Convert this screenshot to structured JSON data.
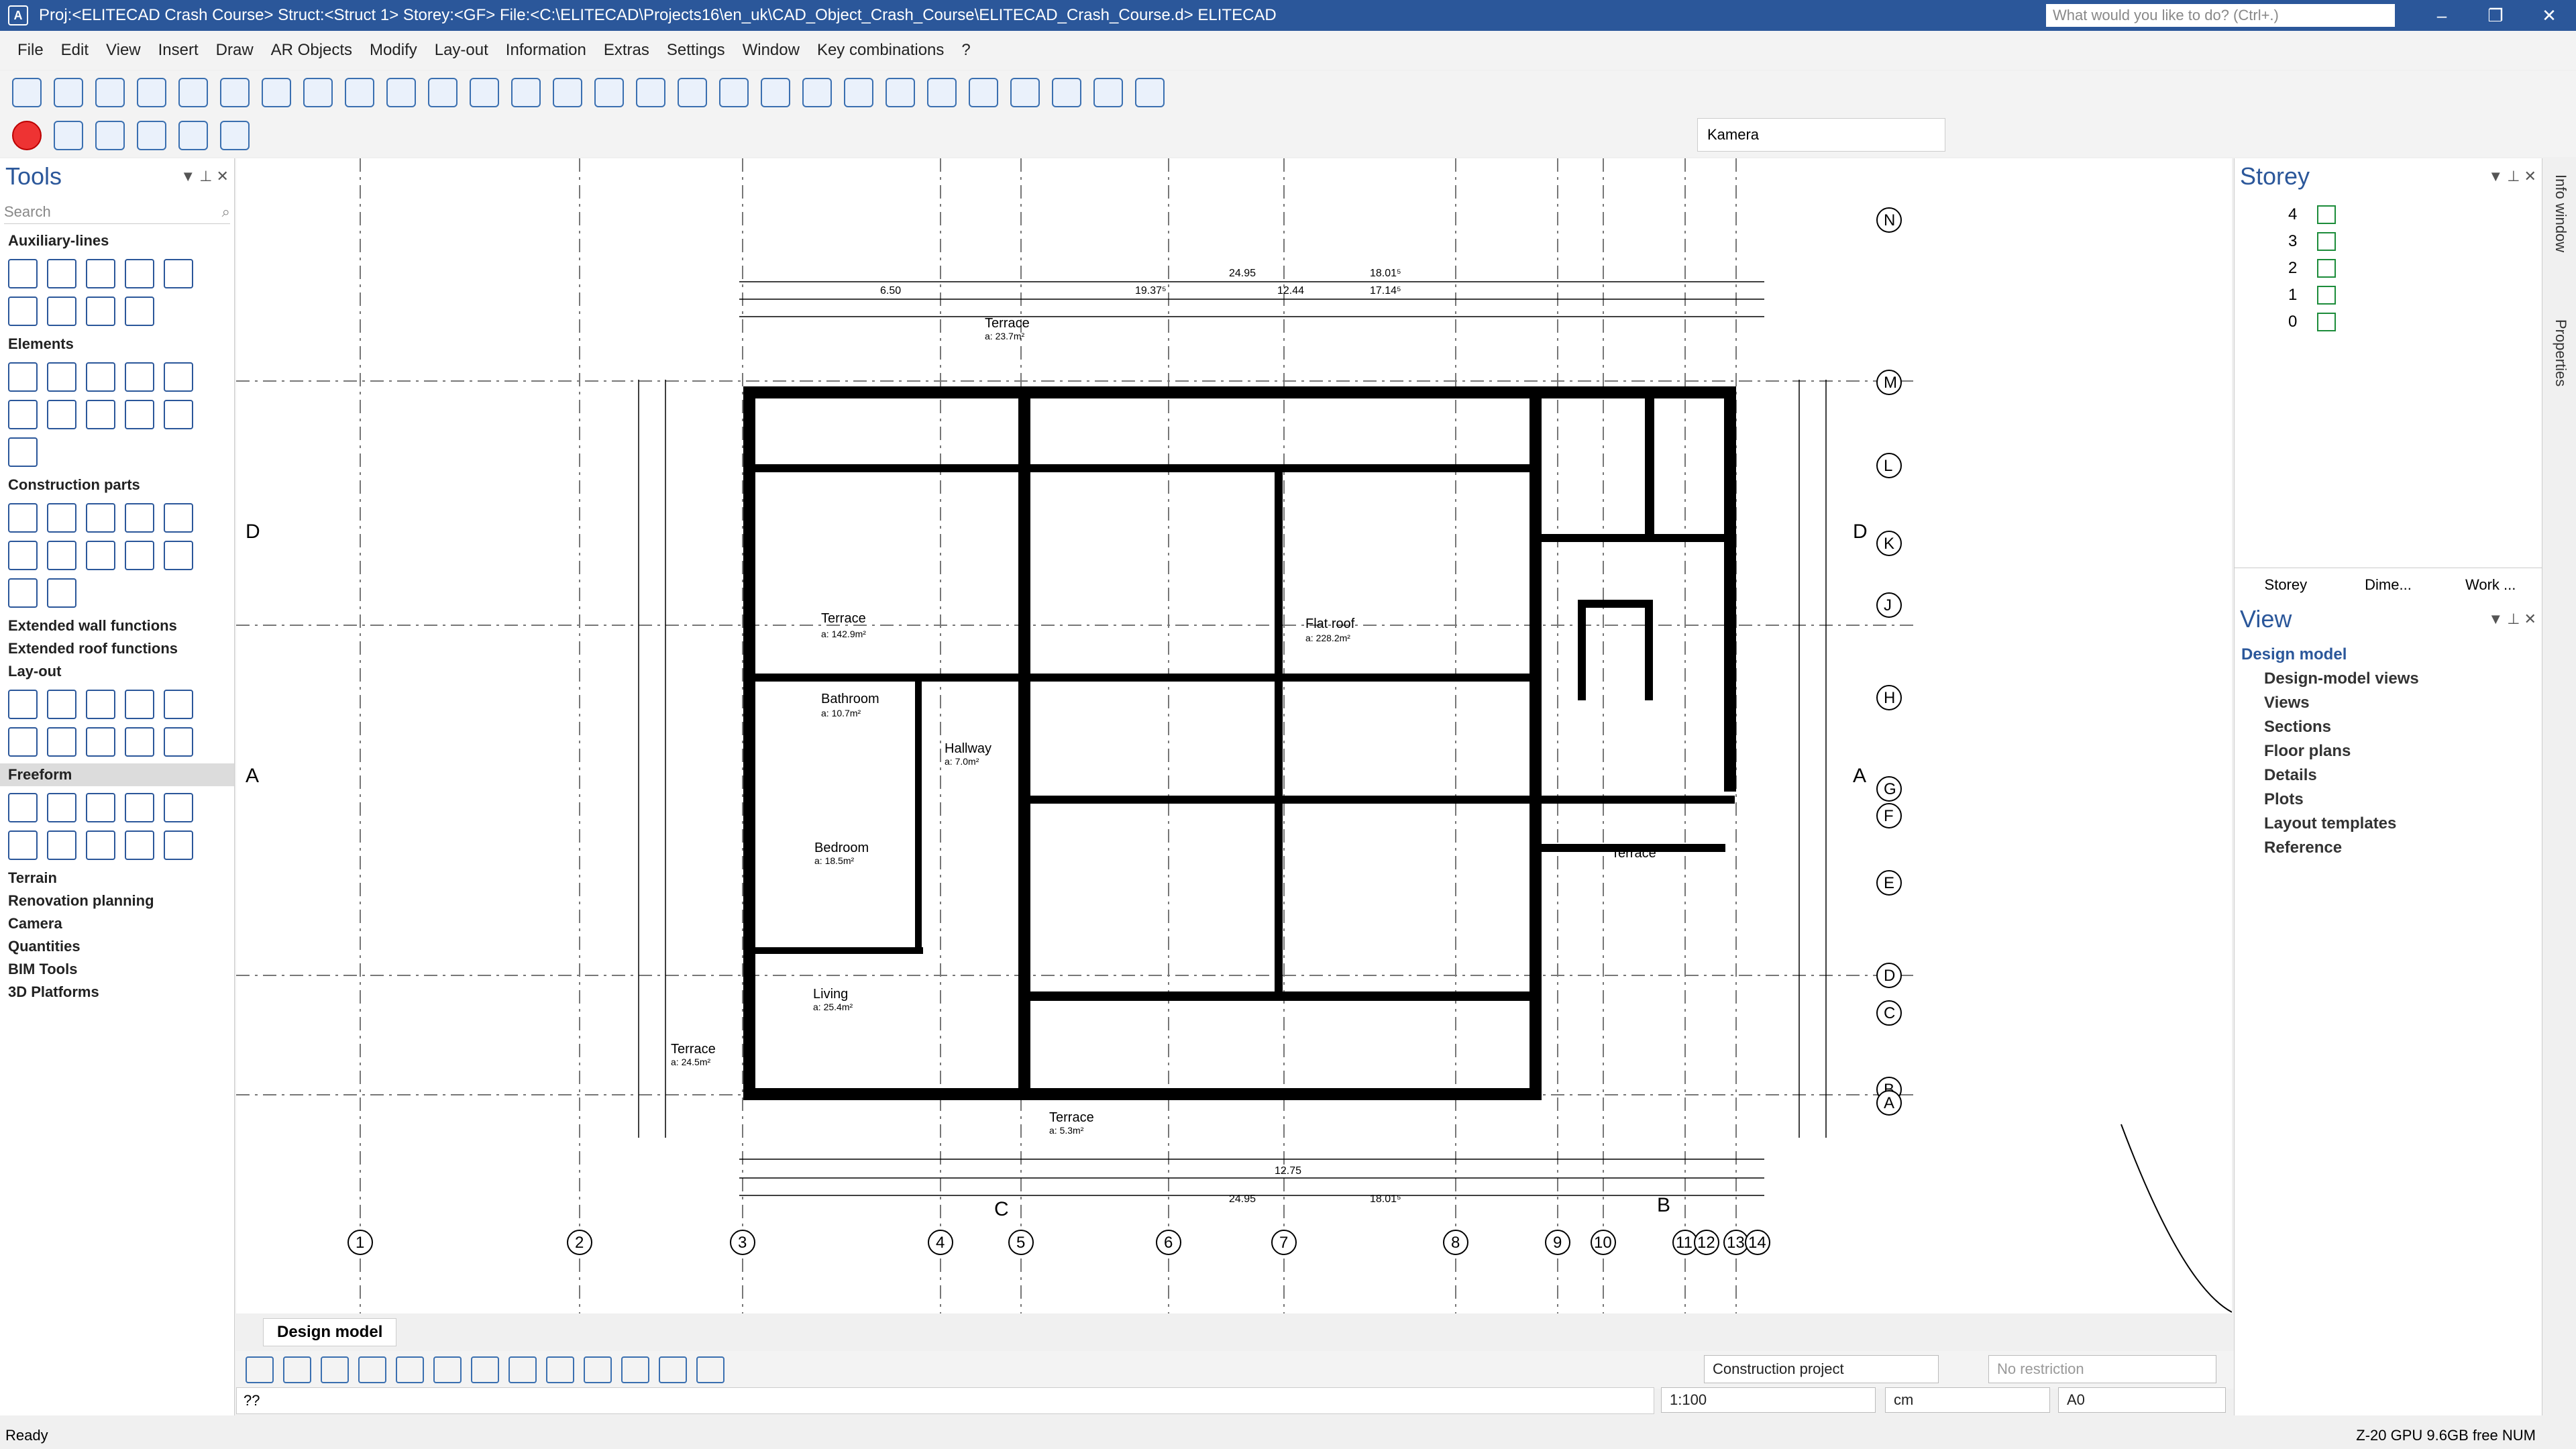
{
  "titlebar": {
    "title": "Proj:<ELITECAD Crash Course>  Struct:<Struct 1>  Storey:<GF>  File:<C:\\ELITECAD\\Projects16\\en_uk\\CAD_Object_Crash_Course\\ELITECAD_Crash_Course.d>  ELITECAD",
    "search_placeholder": "What would you like to do? (Ctrl+.)",
    "minimize": "–",
    "restore": "❐",
    "close": "✕"
  },
  "menu": [
    "File",
    "Edit",
    "View",
    "Insert",
    "Draw",
    "AR Objects",
    "Modify",
    "Lay-out",
    "Information",
    "Extras",
    "Settings",
    "Window",
    "Key combinations",
    "?"
  ],
  "kamera": "Kamera",
  "tools": {
    "title": "Tools",
    "search": "Search",
    "sections": {
      "aux": "Auxiliary-lines",
      "elements": "Elements",
      "construction": "Construction parts",
      "ext_wall": "Extended wall functions",
      "ext_roof": "Extended roof functions",
      "layout": "Lay-out",
      "freeform": "Freeform",
      "terrain": "Terrain",
      "renovation": "Renovation planning",
      "camera": "Camera",
      "quantities": "Quantities",
      "bim": "BIM Tools",
      "platforms": "3D Platforms"
    }
  },
  "storey": {
    "title": "Storey",
    "levels": [
      "4",
      "3",
      "2",
      "1",
      "0"
    ],
    "tabs": [
      "Storey",
      "Dime...",
      "Work ..."
    ]
  },
  "view": {
    "title": "View",
    "root": "Design model",
    "items": [
      "Design-model views",
      "Views",
      "Sections",
      "Floor plans",
      "Details",
      "Plots",
      "Layout templates",
      "Reference"
    ]
  },
  "side": {
    "info": "Info window",
    "props": "Properties"
  },
  "plan": {
    "rooms": [
      {
        "name": "Terrace",
        "area": "a: 142.9m²"
      },
      {
        "name": "Flat roof",
        "area": "a: 228.2m²"
      },
      {
        "name": "Bathroom",
        "area": "a: 10.7m²"
      },
      {
        "name": "Hallway",
        "area": "a: 7.0m²"
      },
      {
        "name": "Bedroom",
        "area": "a: 18.5m²"
      },
      {
        "name": "Living",
        "area": "a: 25.4m²"
      },
      {
        "name": "Terrace",
        "area": "a: 24.5m²"
      },
      {
        "name": "Terrace",
        "area": "a: 5.3m²"
      },
      {
        "name": "Terrace",
        "area": "a: 23.7m²"
      },
      {
        "name": "Terrace",
        "area": ""
      }
    ],
    "grid_bottom": [
      "1",
      "2",
      "3",
      "4",
      "5",
      "6",
      "7",
      "8",
      "9",
      "10",
      "11",
      "12",
      "13",
      "14"
    ],
    "grid_right": [
      "N",
      "M",
      "L",
      "K",
      "J",
      "H",
      "G",
      "F",
      "E",
      "D",
      "C",
      "B",
      "A"
    ],
    "dims": [
      "24.95",
      "18.01⁵",
      "6.50",
      "19.37⁵",
      "12.44",
      "17.14⁵",
      "12.75"
    ],
    "sections": [
      "D",
      "A",
      "C",
      "B"
    ]
  },
  "tab": "Design model",
  "combos": {
    "project": "Construction project",
    "restriction": "No restriction",
    "scale": "1:100",
    "unit": "cm",
    "paper": "A0"
  },
  "cmdline": "??",
  "status": {
    "left": "Ready",
    "right": "Z-20        GPU 9.6GB free   NUM"
  }
}
